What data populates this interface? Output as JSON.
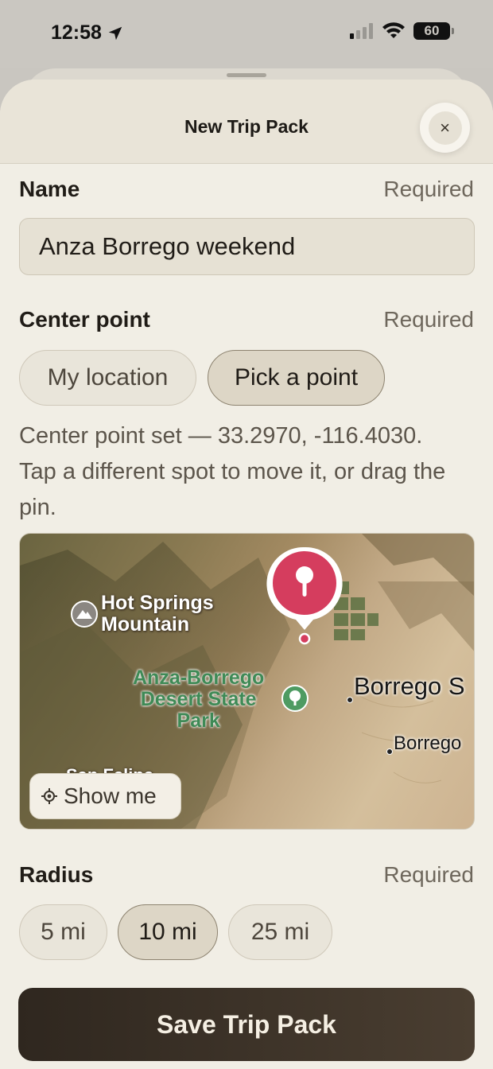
{
  "status_bar": {
    "time": "12:58",
    "battery": "60"
  },
  "sheet": {
    "title": "New Trip Pack",
    "close_icon": "×"
  },
  "name": {
    "label": "Name",
    "required": "Required",
    "value": "Anza Borrego weekend"
  },
  "center_point": {
    "label": "Center point",
    "required": "Required",
    "options": [
      {
        "label": "My location",
        "selected": false
      },
      {
        "label": "Pick a point",
        "selected": true
      }
    ],
    "help": "Center point set — 33.2970, -116.4030. Tap a different spot to move it, or drag the pin."
  },
  "map": {
    "labels": {
      "hot_springs": "Hot Springs\nMountain",
      "anza": "Anza-Borrego\nDesert State\nPark",
      "borrego_springs": "Borrego S",
      "borrego": "Borrego",
      "san_felipe": "San Felipe"
    },
    "show_me": "Show me"
  },
  "radius": {
    "label": "Radius",
    "required": "Required",
    "options": [
      {
        "label": "5 mi",
        "selected": false
      },
      {
        "label": "10 mi",
        "selected": true
      },
      {
        "label": "25 mi",
        "selected": false
      }
    ]
  },
  "save_label": "Save Trip Pack"
}
